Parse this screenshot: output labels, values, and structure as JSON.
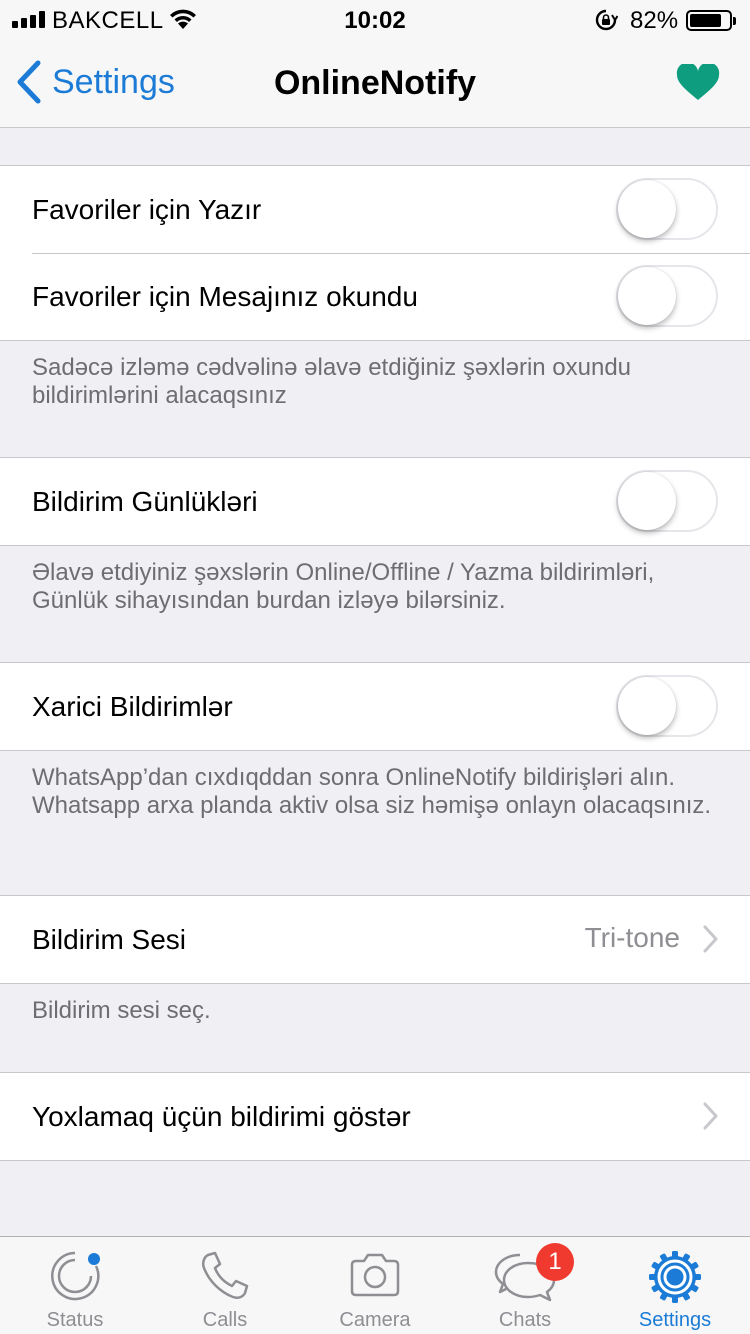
{
  "status_bar": {
    "carrier": "BAKCELL",
    "time": "10:02",
    "battery_percent": "82%",
    "battery_level": 0.82
  },
  "nav": {
    "back_label": "Settings",
    "title": "OnlineNotify",
    "favorite_icon": "heart-icon",
    "favorite_color": "#0e9e7f",
    "accent_color": "#1b7bd6"
  },
  "sections": {
    "favorites": {
      "rows": [
        {
          "label": "Favoriler için Yazır",
          "on": false
        },
        {
          "label": "Favoriler için Mesajınız okundu",
          "on": false
        }
      ],
      "footer": "Sadəcə izləmə cədvəlinə əlavə etdiğiniz şəxlərin oxundu bildirimlərini alacaqsınız"
    },
    "logs": {
      "label": "Bildirim Günlükləri",
      "on": false,
      "footer": "Əlavə etdiyiniz şəxslərin Online/Offline / Yazma bildirimləri, Günlük sihayısından burdan izləyə bilərsiniz."
    },
    "external": {
      "label": "Xarici Bildirimlər",
      "on": false,
      "footer": "WhatsApp’dan cıxdıqddan sonra OnlineNotify bildirişləri alın. Whatsapp arxa planda aktiv olsa siz həmişə onlayn olacaqsınız."
    },
    "sound": {
      "label": "Bildirim Sesi",
      "value": "Tri-tone",
      "footer": "Bildirim sesi seç."
    },
    "test": {
      "label": "Yoxlamaq üçün bildirimi göstər"
    }
  },
  "tabs": [
    {
      "label": "Status",
      "icon": "status-icon"
    },
    {
      "label": "Calls",
      "icon": "phone-icon"
    },
    {
      "label": "Camera",
      "icon": "camera-icon"
    },
    {
      "label": "Chats",
      "icon": "chat-bubbles-icon",
      "badge": "1"
    },
    {
      "label": "Settings",
      "icon": "gear-icon",
      "active": true
    }
  ]
}
